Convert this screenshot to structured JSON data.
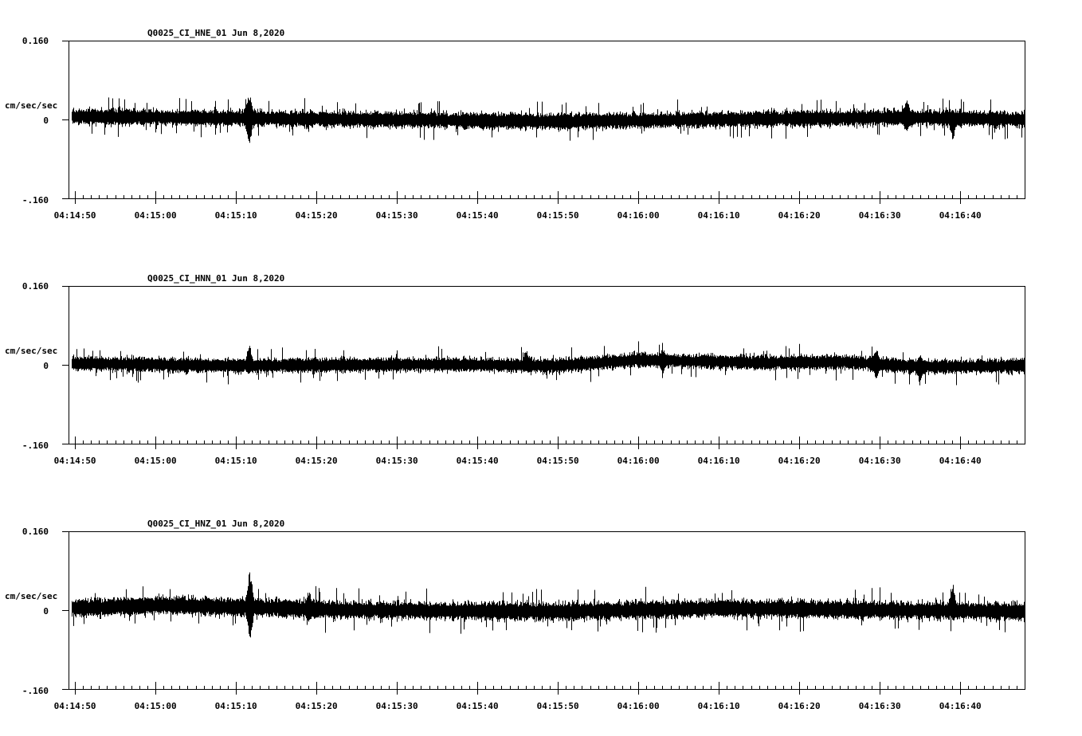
{
  "chart_data": [
    {
      "type": "line",
      "title": "Q0025_CI_HNE_01  Jun 8,2020",
      "ylabel": "cm/sec/sec",
      "ylim": [
        -0.16,
        0.16
      ],
      "yticks": [
        "0.160",
        "0",
        "-.160"
      ],
      "xtick_labels": [
        "04:14:50",
        "04:15:00",
        "04:15:10",
        "04:15:20",
        "04:15:30",
        "04:15:40",
        "04:15:50",
        "04:16:00",
        "04:16:10",
        "04:16:20",
        "04:16:30",
        "04:16:40"
      ],
      "xlim_seconds": [
        -0.8,
        118.0
      ],
      "signal_start_seconds": -0.4,
      "noise_amplitude": 0.018,
      "events": [
        {
          "t": 21.6,
          "max": 0.055,
          "min": -0.053
        },
        {
          "t": 103.3,
          "max": 0.042,
          "min": -0.03
        },
        {
          "t": 109.0,
          "max": 0.02,
          "min": -0.042
        }
      ],
      "drift": [
        [
          0,
          0.006
        ],
        [
          20,
          0.003
        ],
        [
          60,
          -0.004
        ],
        [
          90,
          0.002
        ],
        [
          103,
          0.004
        ],
        [
          118,
          0.0
        ]
      ],
      "series_color": "#000000"
    },
    {
      "type": "line",
      "title": "Q0025_CI_HNN_01  Jun 8,2020",
      "ylabel": "cm/sec/sec",
      "ylim": [
        -0.16,
        0.16
      ],
      "yticks": [
        "0.160",
        "0",
        "-.160"
      ],
      "xtick_labels": [
        "04:14:50",
        "04:15:00",
        "04:15:10",
        "04:15:20",
        "04:15:30",
        "04:15:40",
        "04:15:50",
        "04:16:00",
        "04:16:10",
        "04:16:20",
        "04:16:30",
        "04:16:40"
      ],
      "xlim_seconds": [
        -0.8,
        118.0
      ],
      "signal_start_seconds": -0.4,
      "noise_amplitude": 0.016,
      "events": [
        {
          "t": 21.6,
          "max": 0.04,
          "min": -0.02
        },
        {
          "t": 56.0,
          "max": 0.03,
          "min": -0.015
        },
        {
          "t": 73.0,
          "max": 0.032,
          "min": -0.018
        },
        {
          "t": 99.5,
          "max": 0.034,
          "min": -0.028
        },
        {
          "t": 105.0,
          "max": 0.024,
          "min": -0.035
        }
      ],
      "drift": [
        [
          0,
          0.003
        ],
        [
          20,
          -0.002
        ],
        [
          45,
          0.001
        ],
        [
          60,
          -0.002
        ],
        [
          70,
          0.01
        ],
        [
          85,
          0.004
        ],
        [
          95,
          0.006
        ],
        [
          105,
          -0.004
        ],
        [
          118,
          -0.002
        ]
      ],
      "series_color": "#000000"
    },
    {
      "type": "line",
      "title": "Q0025_CI_HNZ_01  Jun 8,2020",
      "ylabel": "cm/sec/sec",
      "ylim": [
        -0.16,
        0.16
      ],
      "yticks": [
        "0.160",
        "0",
        "-.160"
      ],
      "xtick_labels": [
        "04:14:50",
        "04:15:00",
        "04:15:10",
        "04:15:20",
        "04:15:30",
        "04:15:40",
        "04:15:50",
        "04:16:00",
        "04:16:10",
        "04:16:20",
        "04:16:30",
        "04:16:40"
      ],
      "xlim_seconds": [
        -0.8,
        118.0
      ],
      "signal_start_seconds": -0.4,
      "noise_amplitude": 0.02,
      "events": [
        {
          "t": 21.7,
          "max": 0.078,
          "min": -0.062
        },
        {
          "t": 29.0,
          "max": 0.04,
          "min": -0.03
        },
        {
          "t": 109.0,
          "max": 0.055,
          "min": -0.015
        }
      ],
      "drift": [
        [
          0,
          0.004
        ],
        [
          10,
          0.01
        ],
        [
          20,
          0.006
        ],
        [
          35,
          0.0
        ],
        [
          60,
          -0.003
        ],
        [
          80,
          0.004
        ],
        [
          118,
          -0.003
        ]
      ],
      "series_color": "#000000"
    }
  ]
}
